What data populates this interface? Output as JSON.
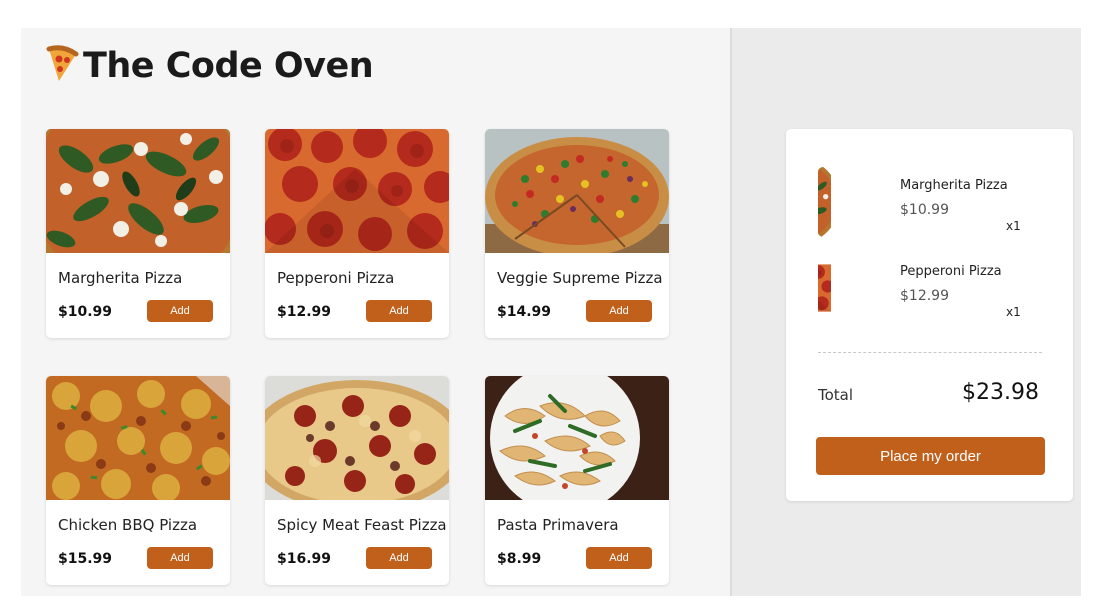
{
  "header": {
    "title": "The Code Oven",
    "logo_icon": "pizza-slice-icon"
  },
  "menu": {
    "items": [
      {
        "name": "Margherita Pizza",
        "price": "$10.99",
        "add_label": "Add"
      },
      {
        "name": "Pepperoni Pizza",
        "price": "$12.99",
        "add_label": "Add"
      },
      {
        "name": "Veggie Supreme Pizza",
        "price": "$14.99",
        "add_label": "Add"
      },
      {
        "name": "Chicken BBQ Pizza",
        "price": "$15.99",
        "add_label": "Add"
      },
      {
        "name": "Spicy Meat Feast Pizza",
        "price": "$16.99",
        "add_label": "Add"
      },
      {
        "name": "Pasta Primavera",
        "price": "$8.99",
        "add_label": "Add"
      }
    ]
  },
  "cart": {
    "items": [
      {
        "name": "Margherita Pizza",
        "price": "$10.99",
        "qty": "x1"
      },
      {
        "name": "Pepperoni Pizza",
        "price": "$12.99",
        "qty": "x1"
      }
    ],
    "total_label": "Total",
    "total_value": "$23.98",
    "order_label": "Place my order"
  },
  "colors": {
    "accent": "#c1601b",
    "panel": "#f5f5f5",
    "cart_bg": "#ebebeb"
  }
}
